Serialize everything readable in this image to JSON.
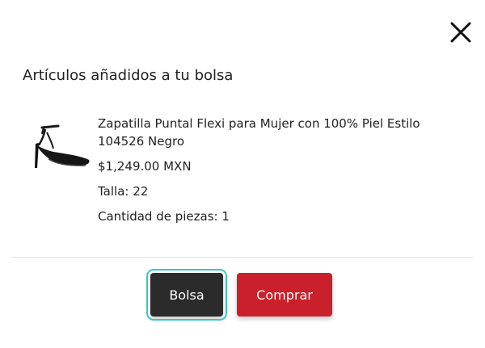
{
  "modal": {
    "heading": "Artículos añadidos a tu bolsa",
    "close_icon": "close-icon"
  },
  "product": {
    "name": "Zapatilla Puntal Flexi para Mujer con 100% Piel Estilo 104526 Negro",
    "price": "$1,249.00 MXN",
    "size_line": "Talla: 22",
    "quantity_line": "Cantidad de piezas: 1",
    "image_alt": "black-high-heel-shoe"
  },
  "actions": {
    "bag_label": "Bolsa",
    "buy_label": "Comprar"
  },
  "colors": {
    "bag_button": "#2b2b2b",
    "bag_focus_ring": "#3bc7c4",
    "buy_button": "#c9202b"
  }
}
